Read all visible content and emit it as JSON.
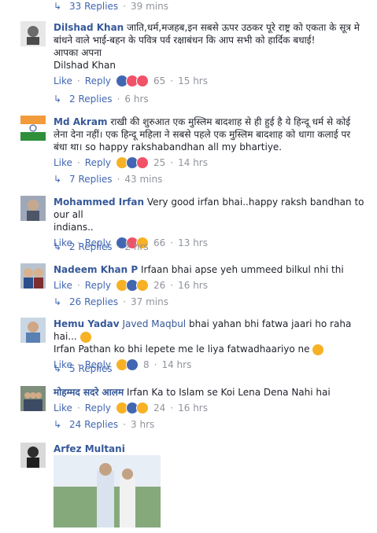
{
  "thread": {
    "top_replies": {
      "label": "33 Replies",
      "sep": "·",
      "time": "39 mins"
    },
    "comments": [
      {
        "name": "Dilshad Khan",
        "text_lines": [
          "जाति,धर्म,मजहब,इन सबसे ऊपर उठकर पूरे राष्ट्र को एकता के सूत्र मे",
          "बांधने वाले भाई-बहन के पवित्र पर्व रक्षाबंधन कि आप सभी को हार्दिक बधाई!",
          "आपका अपना",
          "Dilshad Khan"
        ],
        "like_label": "Like",
        "reply_label": "Reply",
        "reaction_count": "65",
        "time": "15 hrs",
        "replies_label": "2 Replies",
        "replies_time": "6 hrs"
      },
      {
        "name": "Md Akram",
        "text_lines": [
          "राखी की शुरुआत एक मुस्लिम बादशाह से ही हुई है ये हिन्दू धर्म से कोई",
          "लेना देना नहीं। एक हिन्दू महिला ने सबसे पहले एक मुस्लिम बादशाह को धागा कलाई पर",
          "बंधा था। so happy rakshabandhan all my bhartiye."
        ],
        "like_label": "Like",
        "reply_label": "Reply",
        "reaction_count": "25",
        "time": "14 hrs",
        "replies_label": "7 Replies",
        "replies_time": "43 mins"
      },
      {
        "name": "Mohammed Irfan",
        "text_lines": [
          "Very good irfan bhai..happy raksh bandhan to our all",
          "indians.."
        ],
        "like_label": "Like",
        "reply_label": "Reply",
        "reaction_count": "66",
        "time": "13 hrs",
        "replies_label": "2 Replies",
        "replies_time": "2 hrs"
      },
      {
        "name": "Nadeem Khan P",
        "text_lines": [
          "Irfaan bhai apse yeh ummeed bilkul nhi thi"
        ],
        "like_label": "Like",
        "reply_label": "Reply",
        "reaction_count": "26",
        "time": "16 hrs",
        "replies_label": "26 Replies",
        "replies_time": "37 mins"
      },
      {
        "name": "Hemu Yadav",
        "mention": "Javed Maqbul",
        "text_lines": [
          "bhai yahan bhi fatwa jaari ho raha hai...",
          "Irfan Pathan ko bhi lepete me le liya fatwadhaariyo ne"
        ],
        "like_label": "Like",
        "reply_label": "Reply",
        "reaction_count": "8",
        "time": "14 hrs",
        "replies_label": "5 Replies",
        "replies_time": ""
      },
      {
        "name": "मोहम्मद सदरे आलम",
        "text_lines": [
          "Irfan Ka to Islam se Koi Lena Dena Nahi hai"
        ],
        "like_label": "Like",
        "reply_label": "Reply",
        "reaction_count": "24",
        "time": "16 hrs",
        "replies_label": "24 Replies",
        "replies_time": "3 hrs"
      },
      {
        "name": "Arfez Multani"
      }
    ]
  },
  "colors": {
    "link": "#4267b2",
    "name": "#365899",
    "muted": "#90949c",
    "text": "#1d2129"
  },
  "icons": {
    "reply_arrow": "reply-arrow-icon",
    "reaction_like": "like-reaction-icon",
    "reaction_love": "love-reaction-icon",
    "reaction_haha": "haha-reaction-icon",
    "reaction_wow": "wow-reaction-icon"
  }
}
